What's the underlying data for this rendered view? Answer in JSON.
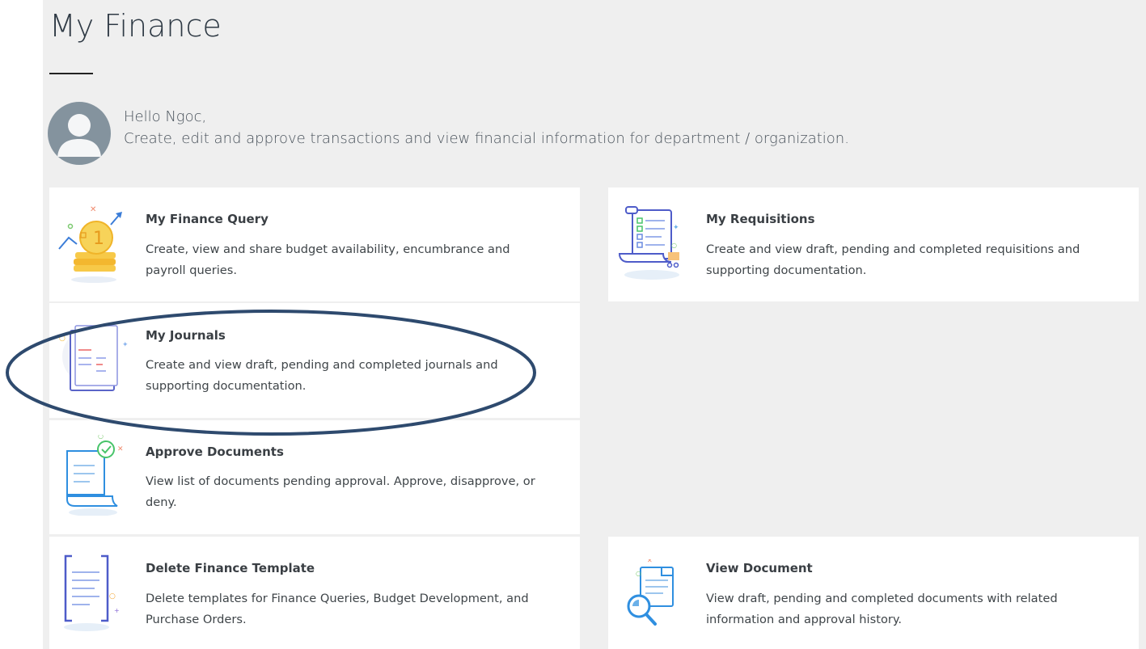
{
  "page": {
    "title": "My Finance"
  },
  "user": {
    "greeting": "Hello Ngoc,",
    "intro": "Create, edit and approve transactions and view financial information for department / organization."
  },
  "tiles": {
    "finance_query": {
      "title": "My Finance Query",
      "desc1": "Create, view and share budget availability, encumbrance and",
      "desc2": "payroll queries.",
      "icon": "gold-coins-icon"
    },
    "journals": {
      "title": "My Journals",
      "desc1": "Create and view draft, pending and completed journals and",
      "desc2": "supporting documentation.",
      "icon": "journal-book-icon"
    },
    "approve": {
      "title": "Approve Documents",
      "desc1": "View list of documents pending approval. Approve, disapprove, or",
      "desc2": "deny.",
      "icon": "document-check-icon"
    },
    "delete_template": {
      "title": "Delete Finance Template",
      "desc1": "Delete templates for Finance Queries, Budget Development, and",
      "desc2": "Purchase Orders.",
      "icon": "template-document-icon"
    },
    "requisitions": {
      "title": "My Requisitions",
      "desc1": "Create and view draft, pending and completed requisitions and",
      "desc2": "supporting documentation.",
      "icon": "requisition-list-icon"
    },
    "view_document": {
      "title": "View Document",
      "desc1": "View draft, pending and completed documents with related",
      "desc2": "information and approval history.",
      "icon": "document-magnifier-icon"
    }
  },
  "colors": {
    "panel_bg": "#efefef",
    "card_bg": "#ffffff",
    "annotation": "#2e4a6e"
  }
}
